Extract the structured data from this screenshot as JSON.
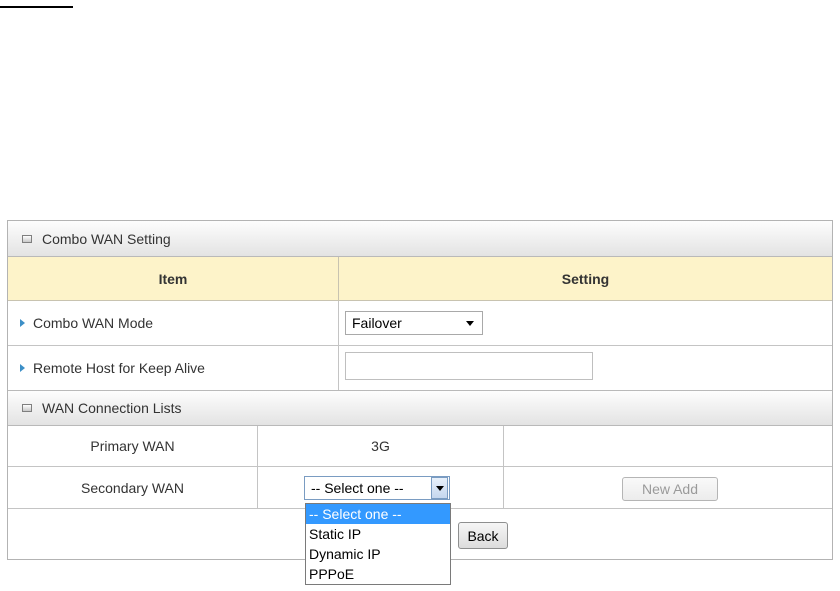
{
  "combo_section": {
    "title": "Combo WAN Setting"
  },
  "table_header": {
    "item": "Item",
    "setting": "Setting"
  },
  "rows": {
    "mode": {
      "label": "Combo WAN Mode",
      "value": "Failover"
    },
    "remote_host": {
      "label": "Remote Host for Keep Alive",
      "value": ""
    }
  },
  "wan_section": {
    "title": "WAN Connection Lists"
  },
  "wan_rows": {
    "primary": {
      "label": "Primary WAN",
      "value": "3G"
    },
    "secondary": {
      "label": "Secondary WAN",
      "value": "-- Select one --",
      "add_button": "New Add"
    }
  },
  "dropdown": {
    "options": [
      "-- Select one --",
      "Static IP",
      "Dynamic IP",
      "PPPoE"
    ],
    "selected_index": 0
  },
  "buttons": {
    "back": "Back"
  },
  "icons": {
    "section": "section-collapse-icon",
    "row_bullet": "arrow-right-icon",
    "dropdown": "chevron-down-icon"
  }
}
